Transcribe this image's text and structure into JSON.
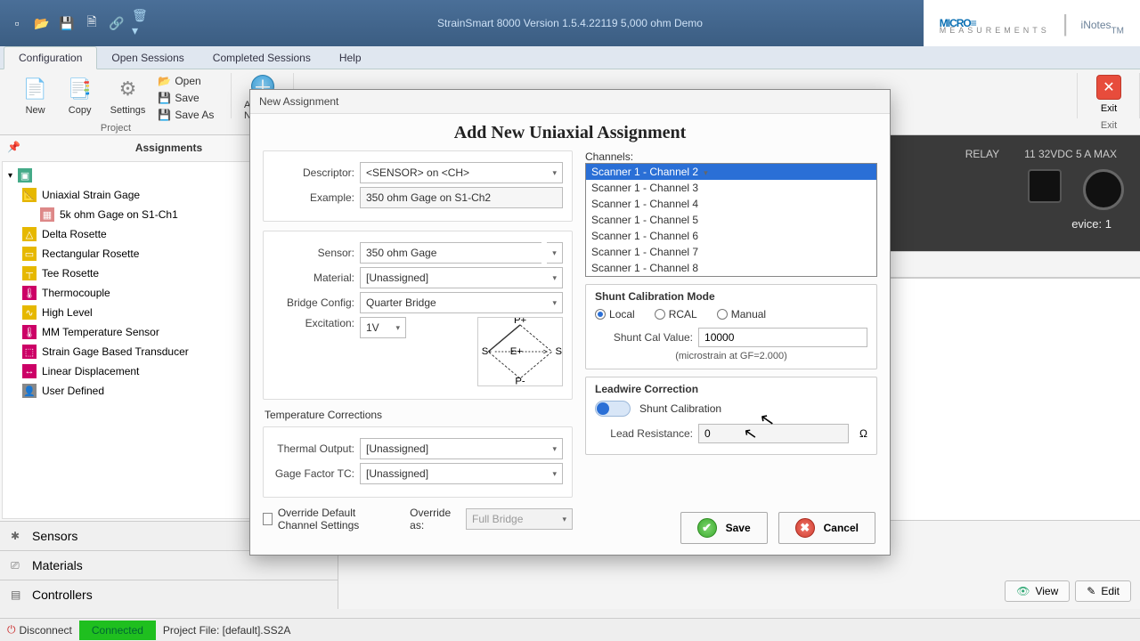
{
  "titlebar": {
    "title": "StrainSmart 8000 Version 1.5.4.22119 5,000 ohm Demo"
  },
  "brand": {
    "name1": "MICRO",
    "name1_sub": "MEASUREMENTS",
    "notes": "iNotes",
    "notes_tm": "TM"
  },
  "tabs": [
    "Configuration",
    "Open Sessions",
    "Completed Sessions",
    "Help"
  ],
  "ribbon": {
    "project": {
      "label": "Project",
      "new": "New",
      "copy": "Copy",
      "settings": "Settings",
      "open": "Open",
      "save": "Save",
      "saveas": "Save As"
    },
    "addnew": "Add New",
    "exit_group": {
      "label": "Exit",
      "btn": "Exit"
    }
  },
  "side": {
    "title": "Assignments",
    "tree": [
      {
        "label": "Uniaxial Strain Gage",
        "icon": "📐",
        "color": "#e6b800"
      },
      {
        "label": "5k ohm Gage on S1-Ch1",
        "icon": "▦",
        "color": "#d88",
        "child": true
      },
      {
        "label": "Delta Rosette",
        "icon": "△",
        "color": "#e6b800"
      },
      {
        "label": "Rectangular Rosette",
        "icon": "▭",
        "color": "#e6b800"
      },
      {
        "label": "Tee Rosette",
        "icon": "┬",
        "color": "#e6b800"
      },
      {
        "label": "Thermocouple",
        "icon": "🌡",
        "color": "#c06"
      },
      {
        "label": "High Level",
        "icon": "∿",
        "color": "#e6b800"
      },
      {
        "label": "MM Temperature Sensor",
        "icon": "🌡",
        "color": "#c06"
      },
      {
        "label": "Strain Gage Based Transducer",
        "icon": "⬚",
        "color": "#c06"
      },
      {
        "label": "Linear Displacement",
        "icon": "↔",
        "color": "#c06"
      },
      {
        "label": "User Defined",
        "icon": "👤",
        "color": "#888"
      }
    ],
    "accordions": [
      {
        "icon": "✱",
        "label": "Sensors"
      },
      {
        "icon": "⎚",
        "label": "Materials"
      },
      {
        "icon": "▤",
        "label": "Controllers"
      }
    ]
  },
  "canvas": {
    "relay": "RELAY",
    "relay2": "11 32VDC 5 A MAX",
    "device": "evice: 1",
    "view": "View",
    "edit": "Edit"
  },
  "status": {
    "disconnect": "Disconnect",
    "connected": "Connected",
    "project": "Project File: [default].SS2A"
  },
  "dlg": {
    "title": "New Assignment",
    "heading": "Add New Uniaxial Assignment",
    "descriptor_lbl": "Descriptor:",
    "descriptor": "<SENSOR> on <CH>",
    "example_lbl": "Example:",
    "example": "350 ohm Gage on S1-Ch2",
    "sensor_lbl": "Sensor:",
    "sensor": "350 ohm Gage",
    "material_lbl": "Material:",
    "material": "[Unassigned]",
    "bridge_lbl": "Bridge Config:",
    "bridge": "Quarter Bridge",
    "excitation_lbl": "Excitation:",
    "excitation": "1V",
    "temp_title": "Temperature Corrections",
    "thermal_lbl": "Thermal Output:",
    "thermal": "[Unassigned]",
    "gftc_lbl": "Gage Factor TC:",
    "gftc": "[Unassigned]",
    "override_cb": "Override Default Channel Settings",
    "override_as": "Override as:",
    "override_val": "Full Bridge",
    "channels_lbl": "Channels:",
    "channels": [
      "Scanner 1 - Channel 2",
      "Scanner 1 - Channel 3",
      "Scanner 1 - Channel 4",
      "Scanner 1 - Channel 5",
      "Scanner 1 - Channel 6",
      "Scanner 1 - Channel 7",
      "Scanner 1 - Channel 8"
    ],
    "shunt_title": "Shunt Calibration Mode",
    "shunt_r1": "Local",
    "shunt_r2": "RCAL",
    "shunt_r3": "Manual",
    "shunt_val_lbl": "Shunt Cal Value:",
    "shunt_val": "10000",
    "shunt_note": "(microstrain at GF=2.000)",
    "lead_title": "Leadwire Correction",
    "lead_toggle": "Shunt Calibration",
    "lead_res_lbl": "Lead Resistance:",
    "lead_res": "0",
    "ohm": "Ω",
    "save": "Save",
    "cancel": "Cancel"
  }
}
